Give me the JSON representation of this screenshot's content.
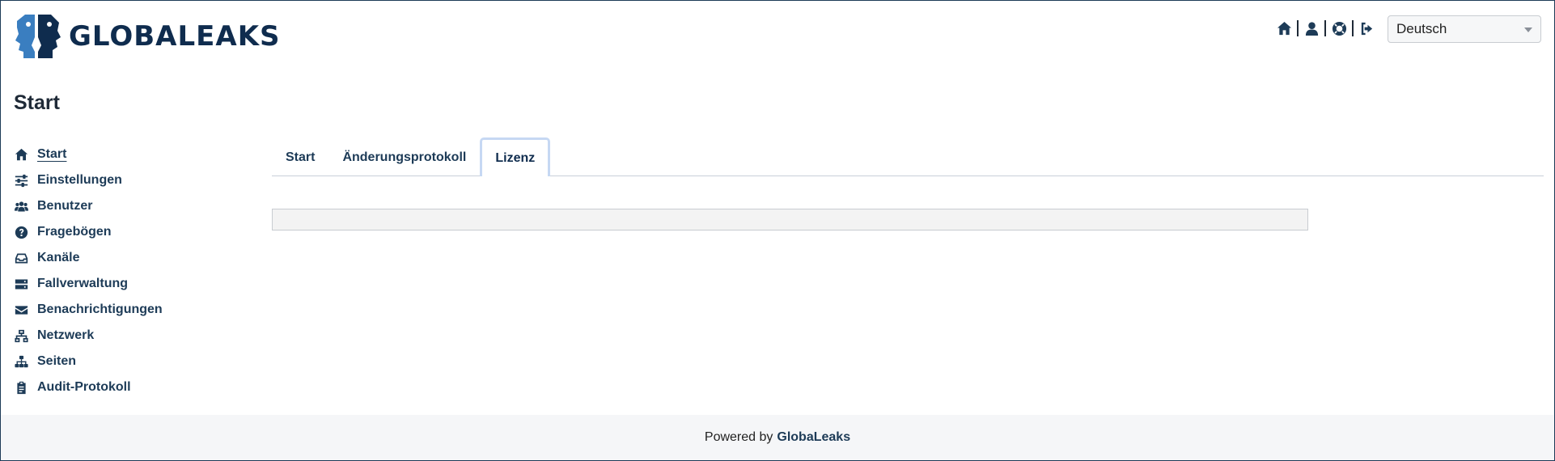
{
  "header": {
    "brand": "GLOBALEAKS",
    "icons": [
      "home-icon",
      "user-icon",
      "support-icon",
      "logout-icon"
    ],
    "language": "Deutsch"
  },
  "page": {
    "title": "Start"
  },
  "sidebar": {
    "items": [
      {
        "label": "Start",
        "icon": "home-icon"
      },
      {
        "label": "Einstellungen",
        "icon": "sliders-icon"
      },
      {
        "label": "Benutzer",
        "icon": "users-icon"
      },
      {
        "label": "Fragebögen",
        "icon": "question-icon"
      },
      {
        "label": "Kanäle",
        "icon": "inbox-icon"
      },
      {
        "label": "Fallverwaltung",
        "icon": "server-icon"
      },
      {
        "label": "Benachrichtigungen",
        "icon": "envelope-icon"
      },
      {
        "label": "Netzwerk",
        "icon": "network-icon"
      },
      {
        "label": "Seiten",
        "icon": "sitemap-icon"
      },
      {
        "label": "Audit-Protokoll",
        "icon": "clipboard-icon"
      }
    ]
  },
  "tabs": [
    {
      "label": "Start"
    },
    {
      "label": "Änderungsprotokoll"
    },
    {
      "label": "Lizenz"
    }
  ],
  "footer": {
    "prefix": "Powered by",
    "brand": "GlobaLeaks"
  },
  "colors": {
    "primary": "#1d3b57",
    "logo_blue": "#3a7ec0",
    "active_tab_border": "#c6d8f3"
  }
}
